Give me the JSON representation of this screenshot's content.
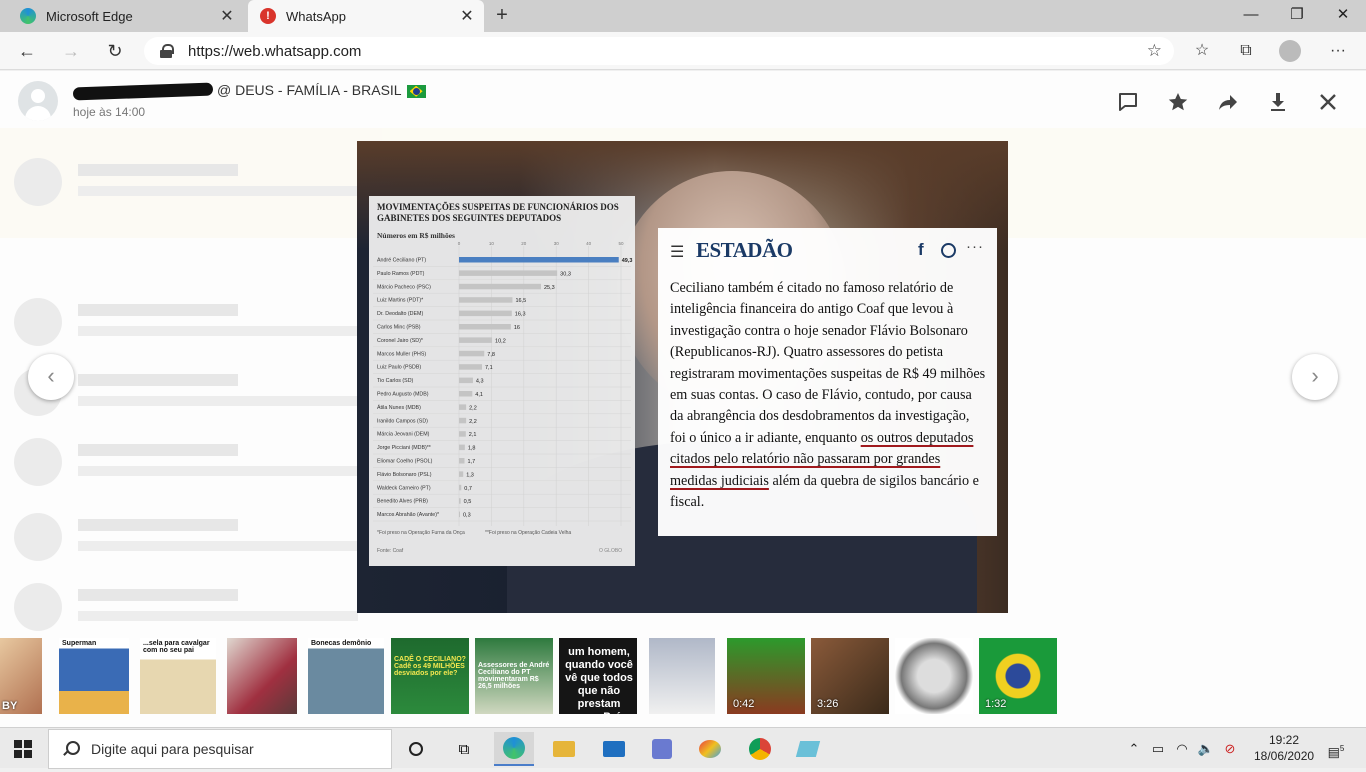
{
  "browser": {
    "tabs": [
      {
        "title": "Microsoft Edge",
        "favicon_color": "#1f8fd8"
      },
      {
        "title": "WhatsApp",
        "favicon_color": "#d9342b"
      }
    ],
    "address": "https://web.whatsapp.com"
  },
  "viewer": {
    "contact_name": "@ DEUS - FAMÍLIA - BRASIL",
    "timestamp": "hoje às 14:00",
    "accent": "#00a884"
  },
  "chart_data": {
    "type": "bar",
    "title": "MOVIMENTAÇÕES SUSPEITAS DE FUNCIONÁRIOS DOS GABINETES DOS SEGUINTES DEPUTADOS",
    "subtitle": "Números em R$ milhões",
    "categories": [
      "André Ceciliano (PT)",
      "Paulo Ramos (PDT)",
      "Márcio Pacheco (PSC)",
      "Luiz Martins (PDT)*",
      "Dr. Deodalto (DEM)",
      "Carlos Minc (PSB)",
      "Coronel Jairo (SD)*",
      "Marcos Muller (PHS)",
      "Luiz Paulo (PSDB)",
      "Tio Carlos (SD)",
      "Pedro Augusto (MDB)",
      "Átila Nunes (MDB)",
      "Iranildo Campos (SD)",
      "Márcia Jeovani (DEM)",
      "Jorge Picciani (MDB)**",
      "Eliomar Coelho (PSOL)",
      "Flávio Bolsonaro (PSL)",
      "Waldeck Carneiro (PT)",
      "Benedito Alves (PRB)",
      "Marcos Abrahão (Avante)*"
    ],
    "values": [
      49.3,
      30.3,
      25.3,
      16.5,
      16.3,
      16,
      10.2,
      7.8,
      7.1,
      4.3,
      4.1,
      2.2,
      2.2,
      2.1,
      1.8,
      1.7,
      1.3,
      0.7,
      0.5,
      0.3
    ],
    "value_labels": [
      "49,3",
      "30,3",
      "25,3",
      "16,5",
      "16,3",
      "16",
      "10,2",
      "7,8",
      "7,1",
      "4,3",
      "4,1",
      "2,2",
      "2,2",
      "2,1",
      "1,8",
      "1,7",
      "1,3",
      "0,7",
      "0,5",
      "0,3"
    ],
    "xticks": [
      0,
      10,
      20,
      30,
      40,
      50
    ],
    "xlim": [
      0,
      50
    ],
    "highlight_color": "#4a7fc1",
    "bar_color": "#c4c4c4",
    "notes": [
      "*Foi preso na Operação Furna da Onça",
      "**Foi preso na Operação Cadeia Velha"
    ],
    "source": "Fonte: Coaf",
    "brand": "O GLOBO"
  },
  "article": {
    "logo": "ESTADÃO",
    "text_before": "Ceciliano também é citado no famoso relatório de inteligência financeira do antigo Coaf que levou à investigação contra o hoje senador Flávio Bolsonaro (Republicanos-RJ). Quatro assessores do petista registraram movimentações suspeitas de R$ 49 milhões em suas contas. O caso de Flávio, contudo, por causa da abrangência dos desdobramentos da investigação, foi o único a ir adiante, enquanto ",
    "text_underlined": "os outros deputados citados pelo relatório não passaram por grandes medidas judiciais",
    "text_after": " além da quebra de sigilos bancário e fiscal."
  },
  "thumbnails": [
    {
      "caption": "BY",
      "dur": ""
    },
    {
      "caption": "Superman",
      "dur": ""
    },
    {
      "caption": "...sela para cavalgar com no seu pai",
      "dur": ""
    },
    {
      "caption": "",
      "dur": ""
    },
    {
      "caption": "Bonecas demônio",
      "dur": ""
    },
    {
      "caption": "CADÊ O CECILIANO? Cadê os 49 MILHÕES desviados por ele?",
      "dur": ""
    },
    {
      "caption": "Assessores de André Ceciliano do PT movimentaram R$ 26,5 milhões",
      "dur": ""
    },
    {
      "caption": "um homem, quando você vê que todos que não prestam nesse País,",
      "dur": ""
    },
    {
      "caption": "",
      "dur": ""
    },
    {
      "caption": "",
      "dur": "0:42"
    },
    {
      "caption": "",
      "dur": "3:26"
    },
    {
      "caption": "",
      "dur": ""
    },
    {
      "caption": "",
      "dur": "1:32"
    }
  ],
  "taskbar": {
    "search_placeholder": "Digite aqui para pesquisar",
    "time": "19:22",
    "date": "18/06/2020",
    "notifications": "5"
  }
}
